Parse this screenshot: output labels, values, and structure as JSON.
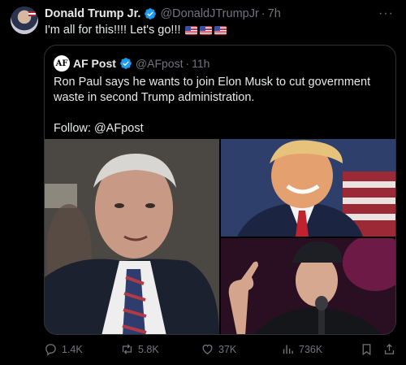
{
  "post": {
    "author_name": "Donald Trump Jr.",
    "handle": "@DonaldJTrumpJr",
    "separator": "·",
    "time": "7h",
    "text": "I'm all for this!!!! Let's go!!!",
    "more_label": "···"
  },
  "quote": {
    "avatar_text": "AF",
    "author_name": "AF Post",
    "handle": "@AFpost",
    "separator": "·",
    "time": "11h",
    "text_line1": "Ron Paul says he wants to join Elon Musk to cut government waste in second Trump administration.",
    "text_line2": "Follow: @AFpost"
  },
  "actions": {
    "replies": "1.4K",
    "reposts": "5.8K",
    "likes": "37K",
    "views": "736K"
  },
  "icons": {
    "verified": "verified-badge-icon",
    "reply": "reply-icon",
    "repost": "repost-icon",
    "like": "heart-icon",
    "views": "views-icon",
    "bookmark": "bookmark-icon",
    "share": "share-icon",
    "flags": "us-flag-icon"
  },
  "colors": {
    "background": "#000000",
    "text": "#e7e9ea",
    "muted": "#71767b",
    "verified": "#1d9bf0",
    "border": "#2f3336"
  }
}
